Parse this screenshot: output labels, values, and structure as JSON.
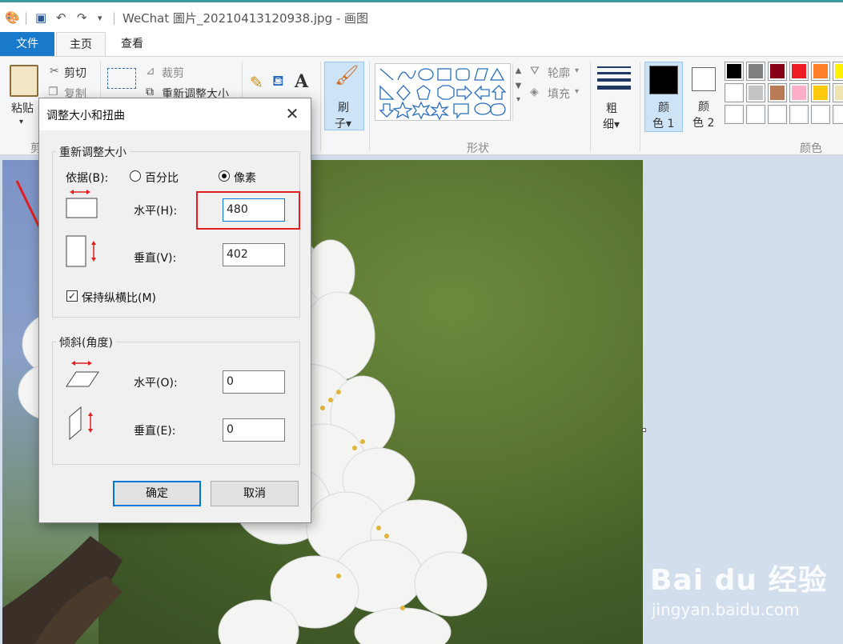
{
  "window": {
    "title": "WeChat 圖片_20210413120938.jpg - 画图"
  },
  "tabs": [
    {
      "label": "文件"
    },
    {
      "label": "主页"
    },
    {
      "label": "查看"
    }
  ],
  "ribbon": {
    "clipboard": {
      "paste": "粘贴",
      "cut": "剪切",
      "copy": "复制",
      "group_partial": "剪"
    },
    "image": {
      "crop": "裁剪",
      "resize": "重新调整大小"
    },
    "brush": {
      "label_line1": "刷",
      "label_line2": "子▾"
    },
    "shapes": {
      "outline": "轮廓",
      "fill": "填充",
      "group": "形状"
    },
    "size": {
      "line1": "粗",
      "line2": "细▾"
    },
    "color1": {
      "line1": "颜",
      "line2": "色 1"
    },
    "color2": {
      "line1": "颜",
      "line2": "色 2"
    },
    "colors_group": "颜色",
    "palette_row1": [
      "#000000",
      "#7f7f7f",
      "#880015",
      "#ed1c24",
      "#ff7f27",
      "#fff200"
    ],
    "palette_row2": [
      "#ffffff",
      "#c3c3c3",
      "#b97a57",
      "#ffaec9",
      "#ffc90e",
      "#efe4b0"
    ],
    "palette_row3": [
      "#ffffff",
      "#ffffff",
      "#ffffff",
      "#ffffff",
      "#ffffff",
      "#ffffff"
    ]
  },
  "dialog": {
    "title": "调整大小和扭曲",
    "close": "✕",
    "resize_group": {
      "legend": "重新调整大小",
      "by_label": "依据(B):",
      "option_percent": "百分比",
      "option_pixels": "像素",
      "selected": "像素",
      "horizontal_label": "水平(H):",
      "horizontal_value": "480",
      "vertical_label": "垂直(V):",
      "vertical_value": "402",
      "keep_ratio_label": "保持纵横比(M)",
      "keep_ratio_checked": true
    },
    "skew_group": {
      "legend": "倾斜(角度)",
      "horizontal_label": "水平(O):",
      "horizontal_value": "0",
      "vertical_label": "垂直(E):",
      "vertical_value": "0"
    },
    "ok": "确定",
    "cancel": "取消"
  },
  "watermark": {
    "brand": "Bai du 经验",
    "url": "jingyan.baidu.com"
  },
  "colors": {
    "accent": "#0078d7",
    "file_tab": "#1979ca",
    "annotation": "#e02020"
  }
}
